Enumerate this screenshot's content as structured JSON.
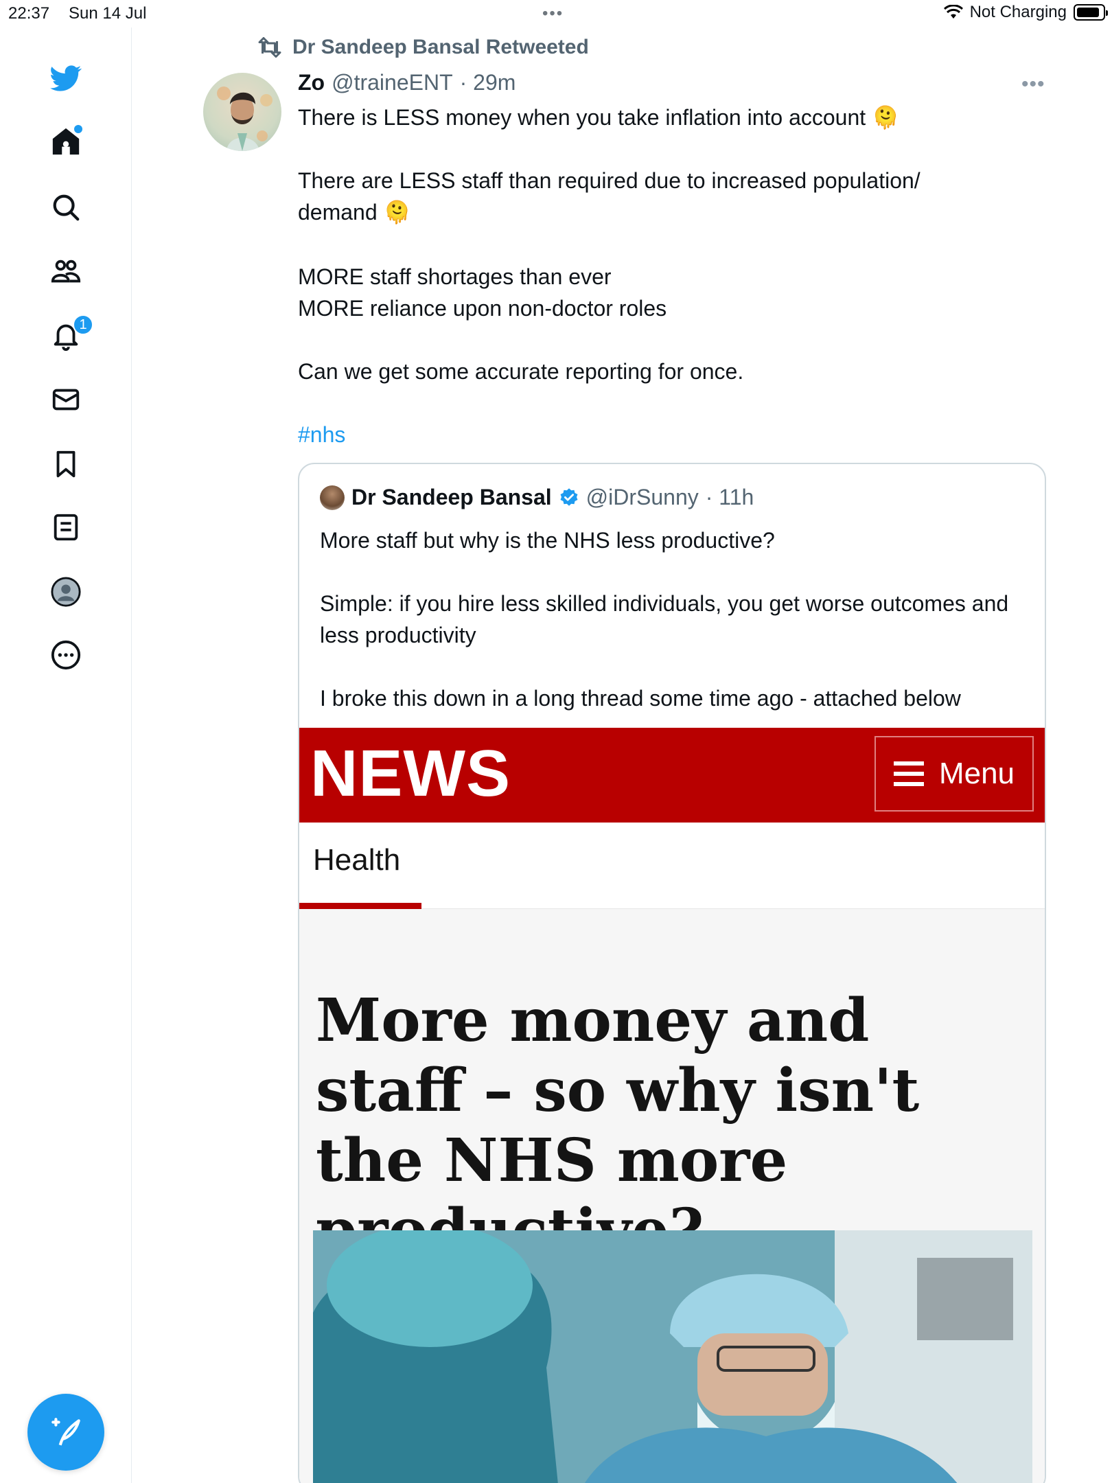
{
  "status_bar": {
    "time": "22:37",
    "date": "Sun 14 Jul",
    "charging": "Not Charging"
  },
  "sidebar": {
    "items": [
      {
        "name": "home",
        "icon": "home-icon"
      },
      {
        "name": "search",
        "icon": "search-icon"
      },
      {
        "name": "communities",
        "icon": "communities-icon"
      },
      {
        "name": "notifications",
        "icon": "bell-icon",
        "badge": "1"
      },
      {
        "name": "messages",
        "icon": "mail-icon"
      },
      {
        "name": "bookmarks",
        "icon": "bookmark-icon"
      },
      {
        "name": "lists",
        "icon": "list-icon"
      },
      {
        "name": "profile",
        "icon": "profile-icon"
      },
      {
        "name": "more",
        "icon": "more-icon"
      }
    ],
    "compose_icon": "compose-icon"
  },
  "tweet": {
    "retweeted_by": "Dr Sandeep Bansal Retweeted",
    "author_name": "Zo",
    "author_handle": "@traineENT",
    "time": "· 29m",
    "lines": [
      "There is LESS money when you take inflation into account 🫠",
      "There are LESS staff than required due to increased population/ demand 🫠",
      "MORE staff shortages than ever",
      "MORE reliance upon non-doctor roles",
      "Can we get some accurate reporting for once."
    ],
    "hashtag": "#nhs"
  },
  "quote": {
    "author_name": "Dr Sandeep Bansal",
    "author_handle": "@iDrSunny",
    "time": "· 11h",
    "lines": [
      "More staff but why is the NHS less productive?",
      "Simple: if you hire less skilled individuals, you get worse outcomes and less productivity",
      "I broke this down in a long thread some time ago - attached below"
    ]
  },
  "article": {
    "brand": "NEWS",
    "menu_label": "Menu",
    "section": "Health",
    "headline": "More money and staff – so why isn't the NHS more productive?"
  },
  "colors": {
    "twitter_blue": "#1d9bf0",
    "bbc_red": "#b80000"
  }
}
